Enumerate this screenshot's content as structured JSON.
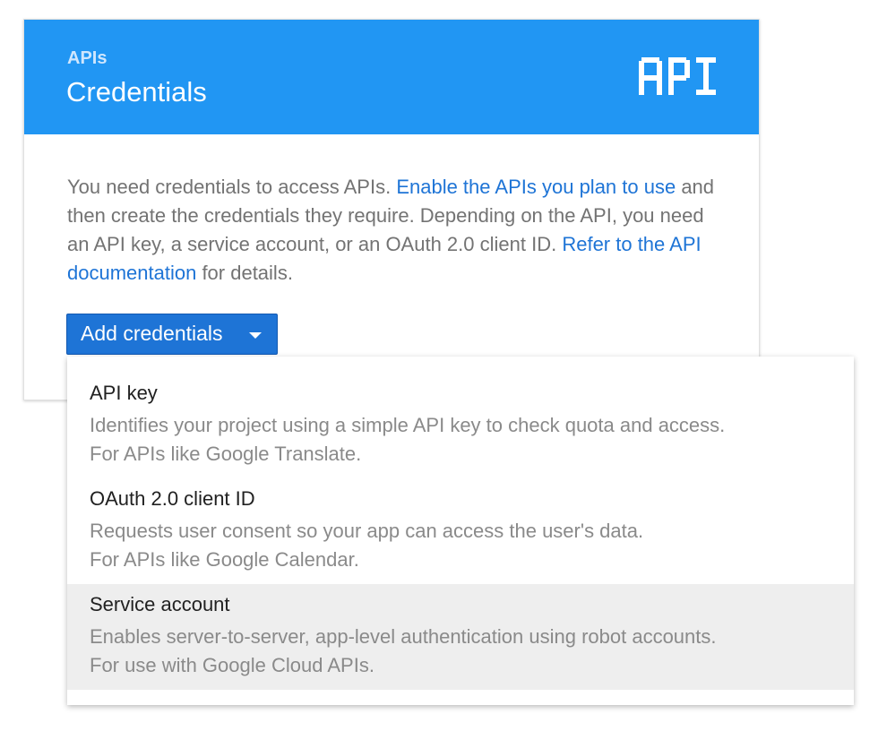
{
  "header": {
    "subtitle": "APIs",
    "title": "Credentials",
    "logo_text": "API"
  },
  "body": {
    "text1": "You need credentials to access APIs. ",
    "link1": "Enable the APIs you plan to use",
    "text2": " and then create the credentials they require. Depending on the API, you need an API key, a service account, or an OAuth 2.0 client ID. ",
    "link2": "Refer to the API documentation",
    "text3": " for details."
  },
  "add_button": {
    "label": "Add credentials",
    "icon": "caret-down-icon"
  },
  "menu": {
    "items": [
      {
        "title": "API key",
        "desc1": "Identifies your project using a simple API key to check quota and access.",
        "desc2": "For APIs like Google Translate."
      },
      {
        "title": "OAuth 2.0 client ID",
        "desc1": "Requests user consent so your app can access the user's data.",
        "desc2": "For APIs like Google Calendar."
      },
      {
        "title": "Service account",
        "desc1": "Enables server-to-server, app-level authentication using robot accounts.",
        "desc2": "For use with Google Cloud APIs."
      }
    ],
    "highlighted_index": 2
  },
  "colors": {
    "header_bg": "#2196f3",
    "link": "#1e74d6",
    "button_bg": "#1e74d6",
    "menu_highlight": "#eeeeee"
  }
}
